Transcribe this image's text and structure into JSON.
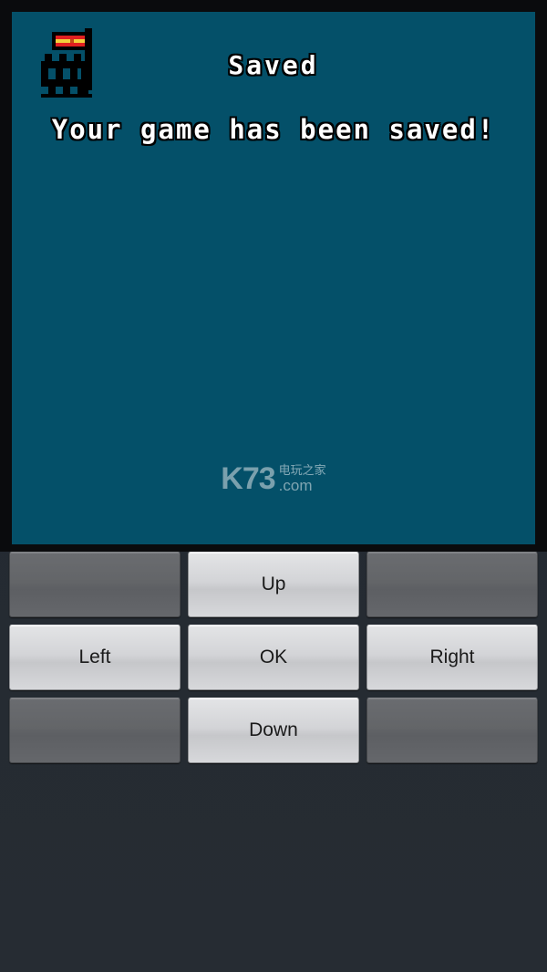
{
  "app": {
    "panel_bg": "#045069",
    "frame_bg": "#0a0b0d",
    "screen_bg": "#242a31"
  },
  "dialog": {
    "icon_name": "castle-flag-icon",
    "title": "Saved",
    "message": "Your game has been saved!"
  },
  "watermark": {
    "brand": "K73",
    "chinese": "电玩之家",
    "domain": ".com"
  },
  "controls": {
    "rows": [
      [
        {
          "label": "",
          "name": "dpad-blank-top-left",
          "state": "blank"
        },
        {
          "label": "Up",
          "name": "dpad-up-button",
          "state": "active"
        },
        {
          "label": "",
          "name": "dpad-blank-top-right",
          "state": "blank"
        }
      ],
      [
        {
          "label": "Left",
          "name": "dpad-left-button",
          "state": "active"
        },
        {
          "label": "OK",
          "name": "dpad-ok-button",
          "state": "active"
        },
        {
          "label": "Right",
          "name": "dpad-right-button",
          "state": "active"
        }
      ],
      [
        {
          "label": "",
          "name": "dpad-blank-bottom-left",
          "state": "blank"
        },
        {
          "label": "Down",
          "name": "dpad-down-button",
          "state": "active"
        },
        {
          "label": "",
          "name": "dpad-blank-bottom-right",
          "state": "blank"
        }
      ]
    ]
  }
}
